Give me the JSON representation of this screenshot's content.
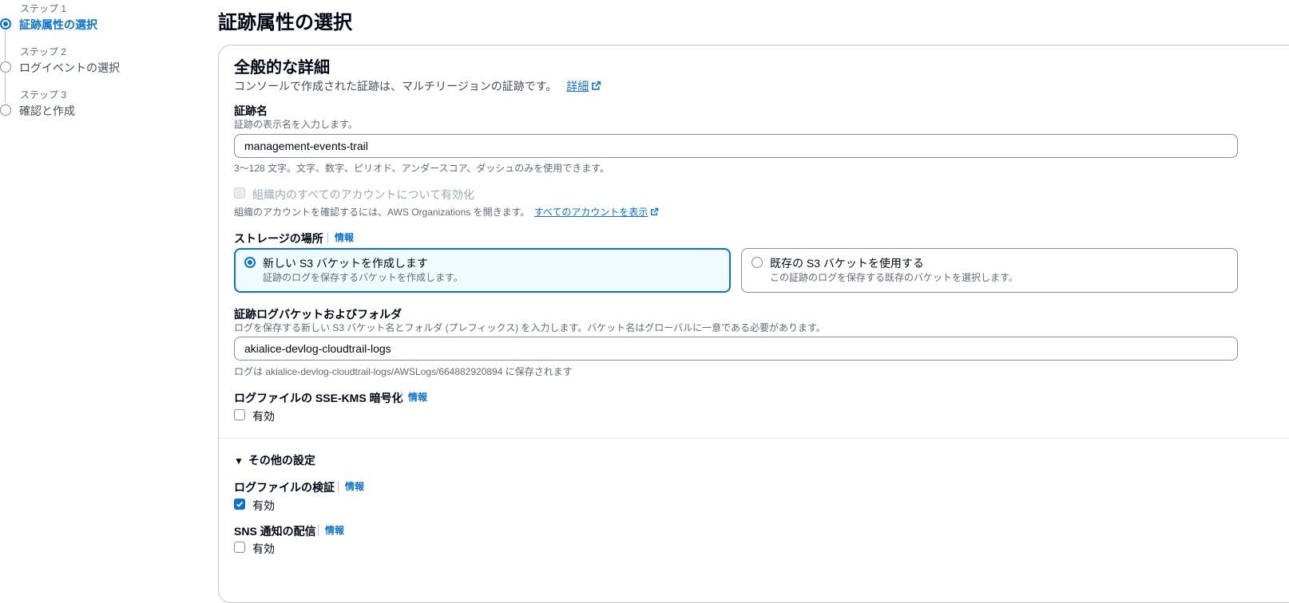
{
  "steps": [
    {
      "label": "ステップ 1",
      "title": "証跡属性の選択"
    },
    {
      "label": "ステップ 2",
      "title": "ログイベントの選択"
    },
    {
      "label": "ステップ 3",
      "title": "確認と作成"
    }
  ],
  "page_title": "証跡属性の選択",
  "general": {
    "title": "全般的な詳細",
    "description": "コンソールで作成された証跡は、マルチリージョンの証跡です。",
    "details_link": "詳細"
  },
  "trail_name": {
    "label": "証跡名",
    "description": "証跡の表示名を入力します。",
    "value": "management-events-trail",
    "constraint": "3〜128 文字。文字、数字、ピリオド、アンダースコア、ダッシュのみを使用できます。"
  },
  "organization": {
    "checkbox_label": "組織内のすべてのアカウントについて有効化",
    "description": "組織のアカウントを確認するには、AWS Organizations を開きます。",
    "link": "すべてのアカウントを表示"
  },
  "storage": {
    "label": "ストレージの場所",
    "info": "情報",
    "options": [
      {
        "title": "新しい S3 バケットを作成します",
        "desc": "証跡のログを保存するバケットを作成します。"
      },
      {
        "title": "既存の S3 バケットを使用する",
        "desc": "この証跡のログを保存する既存のバケットを選択します。"
      }
    ]
  },
  "bucket": {
    "label": "証跡ログバケットおよびフォルダ",
    "description": "ログを保存する新しい S3 バケット名とフォルダ (プレフィックス) を入力します。バケット名はグローバルに一意である必要があります。",
    "value": "akialice-devlog-cloudtrail-logs",
    "hint": "ログは akialice-devlog-cloudtrail-logs/AWSLogs/664882920894 に保存されます"
  },
  "sse_kms": {
    "label": "ログファイルの SSE-KMS 暗号化",
    "info": "情報",
    "checkbox_label": "有効"
  },
  "other_settings": {
    "title": "その他の設定"
  },
  "validation": {
    "label": "ログファイルの検証",
    "info": "情報",
    "checkbox_label": "有効"
  },
  "sns": {
    "label": "SNS 通知の配信",
    "info": "情報",
    "checkbox_label": "有効"
  }
}
